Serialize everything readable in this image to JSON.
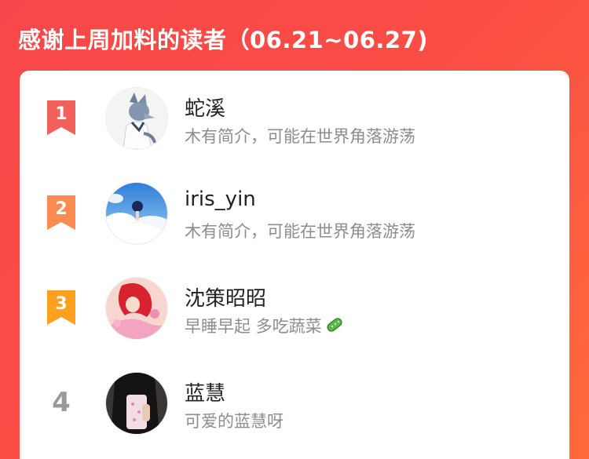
{
  "header": {
    "title": "感谢上周加料的读者（06.21~06.27)"
  },
  "colors": {
    "background_start": "#f8474a",
    "background_end": "#ff6a3a",
    "rank1": "#f2605b",
    "rank2": "#ff8a52",
    "rank3": "#ffa01f",
    "rank_plain": "#9a9a9a"
  },
  "readers": [
    {
      "rank": "1",
      "name": "蛇溪",
      "bio": "木有简介，可能在世界角落游荡",
      "avatar_icon": "wolf-character-avatar"
    },
    {
      "rank": "2",
      "name": "iris_yin",
      "bio": "木有简介，可能在世界角落游荡",
      "avatar_icon": "sky-clouds-avatar"
    },
    {
      "rank": "3",
      "name": "沈策昭昭",
      "bio": "早睡早起 多吃蔬菜",
      "bio_emoji": "cucumber-emoji",
      "avatar_icon": "mermaid-avatar"
    },
    {
      "rank": "4",
      "name": "蓝慧",
      "bio": "可爱的蓝慧呀",
      "avatar_icon": "mirror-selfie-avatar"
    }
  ]
}
